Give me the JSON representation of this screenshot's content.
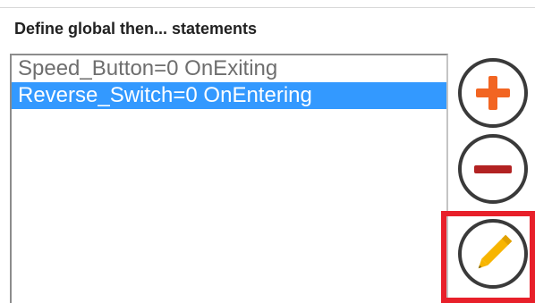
{
  "section": {
    "title": "Define global then... statements"
  },
  "statements": {
    "items": [
      {
        "label": "Speed_Button=0 OnExiting",
        "selected": false
      },
      {
        "label": "Reverse_Switch=0 OnEntering",
        "selected": true
      }
    ],
    "selection_color": "#3399ff"
  },
  "buttons": {
    "add": {
      "icon": "plus-icon",
      "color": "#f26522"
    },
    "remove": {
      "icon": "minus-icon",
      "color": "#b22222"
    },
    "edit": {
      "icon": "pencil-icon",
      "color": "#f7b500"
    }
  },
  "highlight": {
    "target": "edit",
    "color": "#e8202a"
  }
}
